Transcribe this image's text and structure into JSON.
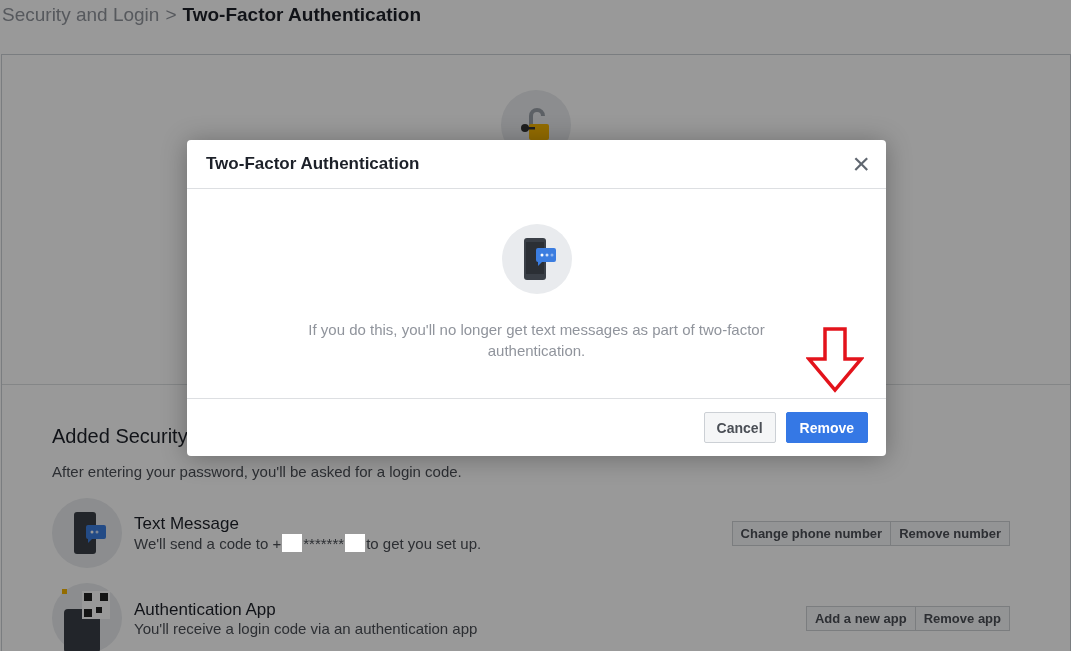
{
  "breadcrumb": {
    "parent": "Security and Login",
    "separator": ">",
    "current": "Two-Factor Authentication"
  },
  "section": {
    "title": "Added Security",
    "subtitle": "After entering your password, you'll be asked for a login code."
  },
  "methods": [
    {
      "kind": "sms",
      "name": "Text Message",
      "description": [
        "We'll send a code to +",
        "*******",
        "to get you set up."
      ],
      "buttons": [
        "Change phone number",
        "Remove number"
      ]
    },
    {
      "kind": "app",
      "name": "Authentication App",
      "description": [
        "You'll receive a login code via an authentication app"
      ],
      "buttons": [
        "Add a new app",
        "Remove app"
      ]
    }
  ],
  "dialog": {
    "title": "Two-Factor Authentication",
    "close": "×",
    "message": "If you do this, you'll no longer get text messages as part of two-factor authentication.",
    "buttons": [
      {
        "label": "Cancel",
        "kind": "secondary"
      },
      {
        "label": "Remove",
        "kind": "primary"
      }
    ]
  }
}
